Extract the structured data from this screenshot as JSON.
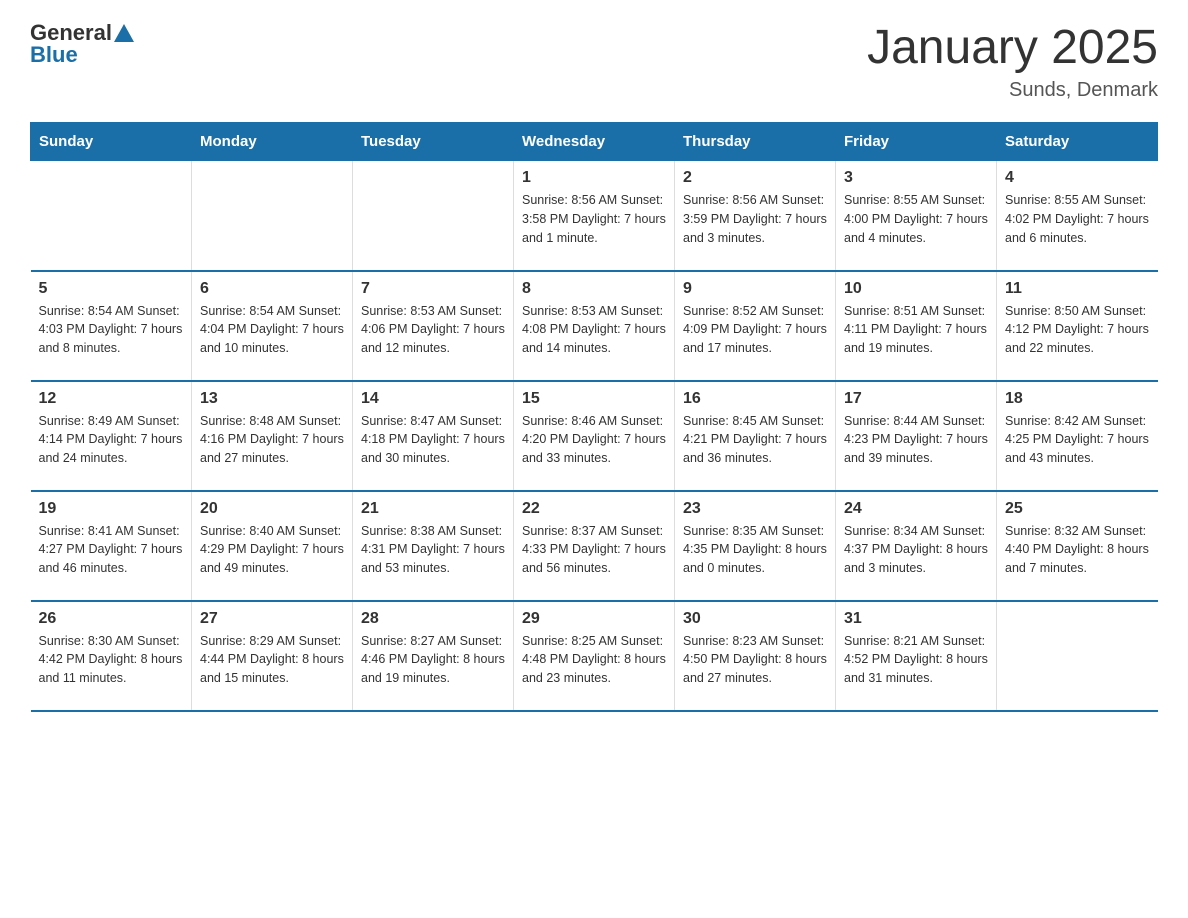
{
  "header": {
    "logo_general": "General",
    "logo_blue": "Blue",
    "title": "January 2025",
    "subtitle": "Sunds, Denmark"
  },
  "columns": [
    "Sunday",
    "Monday",
    "Tuesday",
    "Wednesday",
    "Thursday",
    "Friday",
    "Saturday"
  ],
  "weeks": [
    [
      {
        "day": "",
        "detail": ""
      },
      {
        "day": "",
        "detail": ""
      },
      {
        "day": "",
        "detail": ""
      },
      {
        "day": "1",
        "detail": "Sunrise: 8:56 AM\nSunset: 3:58 PM\nDaylight: 7 hours and 1 minute."
      },
      {
        "day": "2",
        "detail": "Sunrise: 8:56 AM\nSunset: 3:59 PM\nDaylight: 7 hours and 3 minutes."
      },
      {
        "day": "3",
        "detail": "Sunrise: 8:55 AM\nSunset: 4:00 PM\nDaylight: 7 hours and 4 minutes."
      },
      {
        "day": "4",
        "detail": "Sunrise: 8:55 AM\nSunset: 4:02 PM\nDaylight: 7 hours and 6 minutes."
      }
    ],
    [
      {
        "day": "5",
        "detail": "Sunrise: 8:54 AM\nSunset: 4:03 PM\nDaylight: 7 hours and 8 minutes."
      },
      {
        "day": "6",
        "detail": "Sunrise: 8:54 AM\nSunset: 4:04 PM\nDaylight: 7 hours and 10 minutes."
      },
      {
        "day": "7",
        "detail": "Sunrise: 8:53 AM\nSunset: 4:06 PM\nDaylight: 7 hours and 12 minutes."
      },
      {
        "day": "8",
        "detail": "Sunrise: 8:53 AM\nSunset: 4:08 PM\nDaylight: 7 hours and 14 minutes."
      },
      {
        "day": "9",
        "detail": "Sunrise: 8:52 AM\nSunset: 4:09 PM\nDaylight: 7 hours and 17 minutes."
      },
      {
        "day": "10",
        "detail": "Sunrise: 8:51 AM\nSunset: 4:11 PM\nDaylight: 7 hours and 19 minutes."
      },
      {
        "day": "11",
        "detail": "Sunrise: 8:50 AM\nSunset: 4:12 PM\nDaylight: 7 hours and 22 minutes."
      }
    ],
    [
      {
        "day": "12",
        "detail": "Sunrise: 8:49 AM\nSunset: 4:14 PM\nDaylight: 7 hours and 24 minutes."
      },
      {
        "day": "13",
        "detail": "Sunrise: 8:48 AM\nSunset: 4:16 PM\nDaylight: 7 hours and 27 minutes."
      },
      {
        "day": "14",
        "detail": "Sunrise: 8:47 AM\nSunset: 4:18 PM\nDaylight: 7 hours and 30 minutes."
      },
      {
        "day": "15",
        "detail": "Sunrise: 8:46 AM\nSunset: 4:20 PM\nDaylight: 7 hours and 33 minutes."
      },
      {
        "day": "16",
        "detail": "Sunrise: 8:45 AM\nSunset: 4:21 PM\nDaylight: 7 hours and 36 minutes."
      },
      {
        "day": "17",
        "detail": "Sunrise: 8:44 AM\nSunset: 4:23 PM\nDaylight: 7 hours and 39 minutes."
      },
      {
        "day": "18",
        "detail": "Sunrise: 8:42 AM\nSunset: 4:25 PM\nDaylight: 7 hours and 43 minutes."
      }
    ],
    [
      {
        "day": "19",
        "detail": "Sunrise: 8:41 AM\nSunset: 4:27 PM\nDaylight: 7 hours and 46 minutes."
      },
      {
        "day": "20",
        "detail": "Sunrise: 8:40 AM\nSunset: 4:29 PM\nDaylight: 7 hours and 49 minutes."
      },
      {
        "day": "21",
        "detail": "Sunrise: 8:38 AM\nSunset: 4:31 PM\nDaylight: 7 hours and 53 minutes."
      },
      {
        "day": "22",
        "detail": "Sunrise: 8:37 AM\nSunset: 4:33 PM\nDaylight: 7 hours and 56 minutes."
      },
      {
        "day": "23",
        "detail": "Sunrise: 8:35 AM\nSunset: 4:35 PM\nDaylight: 8 hours and 0 minutes."
      },
      {
        "day": "24",
        "detail": "Sunrise: 8:34 AM\nSunset: 4:37 PM\nDaylight: 8 hours and 3 minutes."
      },
      {
        "day": "25",
        "detail": "Sunrise: 8:32 AM\nSunset: 4:40 PM\nDaylight: 8 hours and 7 minutes."
      }
    ],
    [
      {
        "day": "26",
        "detail": "Sunrise: 8:30 AM\nSunset: 4:42 PM\nDaylight: 8 hours and 11 minutes."
      },
      {
        "day": "27",
        "detail": "Sunrise: 8:29 AM\nSunset: 4:44 PM\nDaylight: 8 hours and 15 minutes."
      },
      {
        "day": "28",
        "detail": "Sunrise: 8:27 AM\nSunset: 4:46 PM\nDaylight: 8 hours and 19 minutes."
      },
      {
        "day": "29",
        "detail": "Sunrise: 8:25 AM\nSunset: 4:48 PM\nDaylight: 8 hours and 23 minutes."
      },
      {
        "day": "30",
        "detail": "Sunrise: 8:23 AM\nSunset: 4:50 PM\nDaylight: 8 hours and 27 minutes."
      },
      {
        "day": "31",
        "detail": "Sunrise: 8:21 AM\nSunset: 4:52 PM\nDaylight: 8 hours and 31 minutes."
      },
      {
        "day": "",
        "detail": ""
      }
    ]
  ]
}
